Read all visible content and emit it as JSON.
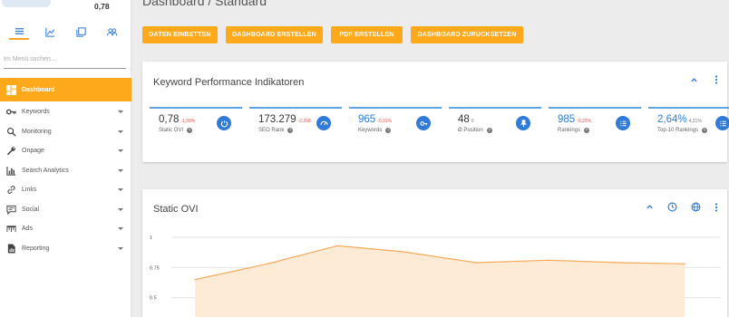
{
  "sidebar": {
    "score": "0,78",
    "nav_icons": [
      "menu-icon",
      "chart-icon",
      "copy-icon",
      "users-icon"
    ],
    "search_placeholder": "Im Menü suchen...",
    "items": [
      {
        "label": "Dashboard",
        "icon": "dashboard-icon",
        "active": true
      },
      {
        "label": "Keywords",
        "icon": "key-icon"
      },
      {
        "label": "Monitoring",
        "icon": "search-icon"
      },
      {
        "label": "Onpage",
        "icon": "wrench-icon"
      },
      {
        "label": "Search Analytics",
        "icon": "bar-chart-icon"
      },
      {
        "label": "Links",
        "icon": "link-icon"
      },
      {
        "label": "Social",
        "icon": "comment-icon"
      },
      {
        "label": "Ads",
        "icon": "ads-icon"
      },
      {
        "label": "Reporting",
        "icon": "report-icon"
      }
    ]
  },
  "header": {
    "title": "Dashboard / Standard"
  },
  "toolbar": {
    "buttons": [
      "DATEN EINBETTEN",
      "DASHBOARD ERSTELLEN",
      "PDF ERSTELLEN",
      "DASHBOARD ZURÜCKSETZEN"
    ]
  },
  "kpi_card": {
    "title": "Keyword Performance Indikatoren",
    "kpis": [
      {
        "value": "0,78",
        "delta": "-1,99%",
        "label": "Static OVI",
        "icon": "gauge-icon",
        "highlight": false
      },
      {
        "value": "173.279",
        "delta": "-2.268",
        "label": "SEO Rank",
        "icon": "speed-icon",
        "highlight": false
      },
      {
        "value": "965",
        "delta": "-0,31%",
        "label": "Keywords",
        "icon": "key-icon",
        "highlight": true
      },
      {
        "value": "48",
        "delta": "0",
        "label": "Ø Position",
        "icon": "pin-icon",
        "highlight": false
      },
      {
        "value": "985",
        "delta": "-0,20%",
        "label": "Rankings",
        "icon": "list-icon",
        "highlight": true
      },
      {
        "value": "2,64%",
        "delta": "4,21%",
        "label": "Top-10 Rankings",
        "icon": "list-icon",
        "highlight": true
      }
    ]
  },
  "chart_card": {
    "title": "Static OVI"
  },
  "chart_data": {
    "type": "area",
    "title": "Static OVI",
    "yticks": [
      "1",
      "0.75",
      "0.5",
      "0.25"
    ],
    "ylim": [
      0.25,
      1
    ],
    "series": [
      {
        "values": [
          0.65,
          0.78,
          0.93,
          0.88,
          0.79,
          0.81,
          0.79,
          0.78
        ]
      }
    ],
    "grid": true
  },
  "colors": {
    "accent": "#fda91b",
    "kpi_blue": "#2f7bd7",
    "negative": "#e55353",
    "line": "#f5a95b",
    "fill": "#fdebd6"
  }
}
